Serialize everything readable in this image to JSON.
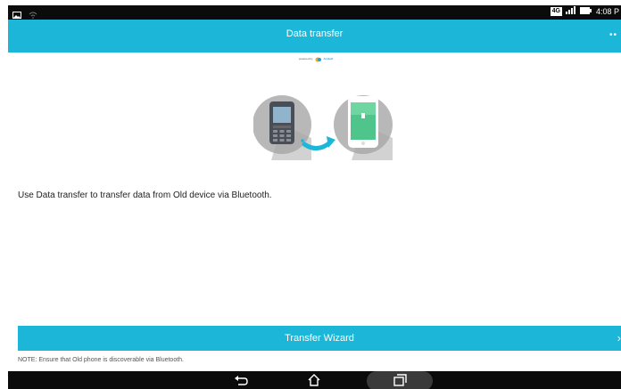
{
  "status_bar": {
    "time": "4:08 P",
    "network_badge": "4G",
    "icons": [
      "gallery-icon",
      "wifi-calling-icon",
      "signal-icon",
      "battery-icon"
    ]
  },
  "app_bar": {
    "title": "Data transfer",
    "overflow_label": "••"
  },
  "powered_by": {
    "text": "powered by",
    "brand": "ArcSoft"
  },
  "illustration": {
    "from_device": "old-phone-icon",
    "to_device": "new-phone-icon",
    "arrow": "transfer-arrow-icon"
  },
  "main": {
    "description": "Use Data transfer to transfer data from Old device via Bluetooth."
  },
  "wizard": {
    "label": "Transfer Wizard",
    "chevron": "›"
  },
  "note": "NOTE: Ensure that Old phone is discoverable via Bluetooth.",
  "nav_bar": {
    "buttons": [
      "back-icon",
      "home-icon",
      "recent-apps-icon"
    ]
  },
  "colors": {
    "accent": "#1bb6d8",
    "status_bar": "#0b0b0b",
    "nav_bar": "#0b0b0b"
  }
}
